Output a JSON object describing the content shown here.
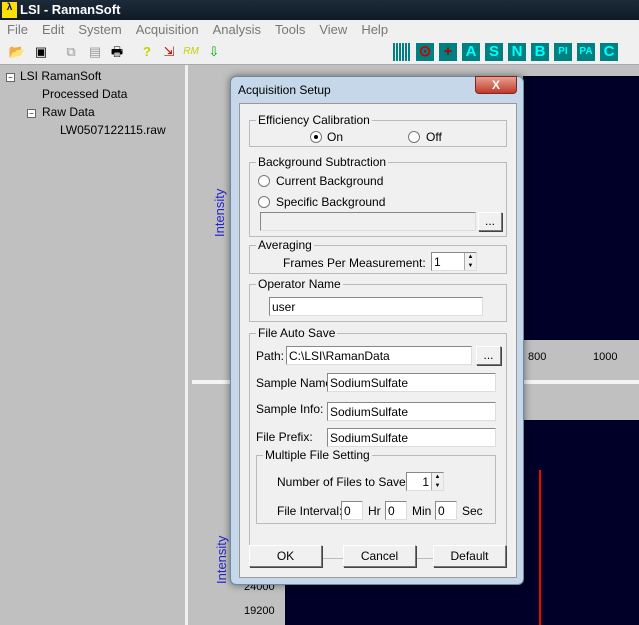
{
  "app": {
    "title": "LSI -  RamanSoft",
    "icon": "lsi-logo-icon"
  },
  "menu": [
    "File",
    "Edit",
    "System",
    "Acquisition",
    "Analysis",
    "Tools",
    "View",
    "Help"
  ],
  "toolbar": {
    "left_icons": [
      "open-folder-icon",
      "save-icon",
      "copy-icon",
      "paste-icon",
      "print-icon",
      "help-icon",
      "acquire-icon",
      "rm-icon",
      "download-icon"
    ],
    "right_buttons": [
      "A",
      "S",
      "N",
      "B",
      "PI",
      "PA",
      "C"
    ],
    "rm_label": "RM",
    "help_label": "?"
  },
  "tree": {
    "root": "LSI RamanSoft",
    "processed": "Processed Data",
    "raw": "Raw Data",
    "file": "LW0507122115.raw"
  },
  "plots": {
    "upper_ylabel": "Intensity",
    "upper_xticks": [
      "800",
      "1000"
    ],
    "lower_ylabel": "Intensity",
    "lower_yticks": [
      "24000",
      "19200"
    ],
    "line_color": "#ff0000",
    "background": "#000028"
  },
  "dialog": {
    "title": "Acquisition Setup",
    "close": "X",
    "efficiency": {
      "legend": "Efficiency Calibration",
      "on": "On",
      "off": "Off",
      "selected": "On"
    },
    "background": {
      "legend": "Background Subtraction",
      "current": "Current  Background",
      "specific": "Specific Background",
      "path": "",
      "browse": "..."
    },
    "averaging": {
      "legend": "Averaging",
      "label": "Frames Per Measurement:",
      "value": "1"
    },
    "operator": {
      "legend": "Operator Name",
      "value": "user"
    },
    "autosave": {
      "legend": "File Auto Save",
      "path_label": "Path:",
      "path": "C:\\LSI\\RamanData",
      "browse": "...",
      "sample_name_label": "Sample Name:",
      "sample_name": "SodiumSulfate",
      "sample_info_label": "Sample Info:",
      "sample_info": "SodiumSulfate",
      "prefix_label": "File Prefix:",
      "prefix": "SodiumSulfate",
      "multi": {
        "legend": "Multiple File Setting",
        "num_label": "Number of Files to Save:",
        "num": "1",
        "interval_label": "File Interval:",
        "hr": "0",
        "hr_label": "Hr",
        "min": "0",
        "min_label": "Min",
        "sec": "0",
        "sec_label": "Sec"
      }
    },
    "buttons": {
      "ok": "OK",
      "cancel": "Cancel",
      "default": "Default"
    }
  }
}
